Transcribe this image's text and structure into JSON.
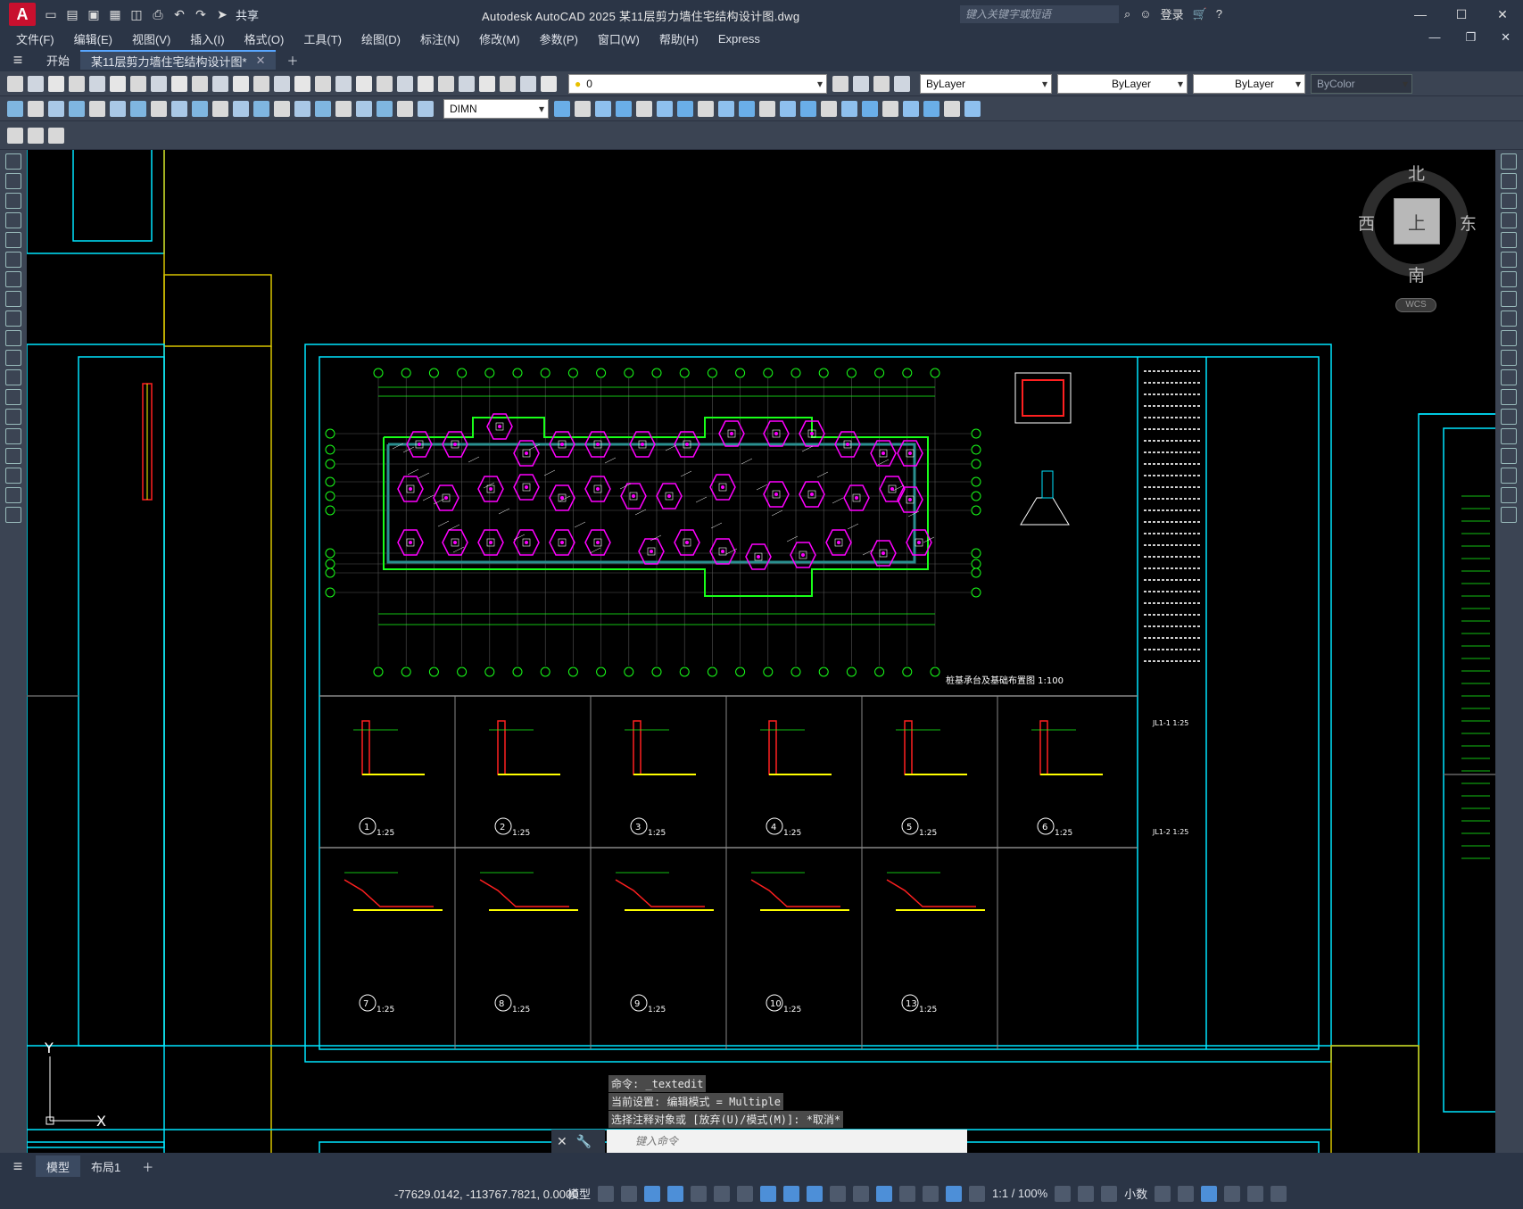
{
  "app": {
    "logo": "A",
    "title": "Autodesk AutoCAD 2025    某11层剪力墙住宅结构设计图.dwg",
    "share_label": "共享",
    "search_placeholder": "键入关键字或短语",
    "login_label": "登录"
  },
  "menu": [
    "文件(F)",
    "编辑(E)",
    "视图(V)",
    "插入(I)",
    "格式(O)",
    "工具(T)",
    "绘图(D)",
    "标注(N)",
    "修改(M)",
    "参数(P)",
    "窗口(W)",
    "帮助(H)",
    "Express"
  ],
  "tabs": [
    {
      "label": "开始"
    },
    {
      "label": "某11层剪力墙住宅结构设计图*"
    }
  ],
  "toolbar": {
    "layer_name": "0",
    "color": "ByLayer",
    "linetype": "ByLayer",
    "lineweight": "ByLayer",
    "plotstyle": "ByColor",
    "dimstyle": "DIMN"
  },
  "viewcube": {
    "north": "北",
    "south": "南",
    "east": "东",
    "west": "西",
    "face": "上",
    "wcs": "WCS"
  },
  "drawing": {
    "plan_title": "桩基承台及基础布置图 1:100",
    "details_row1": [
      "1",
      "2",
      "3",
      "4",
      "5",
      "6"
    ],
    "details_row2": [
      "7",
      "8",
      "9",
      "10",
      "13"
    ],
    "scale_label": "1:25",
    "side_detail_1": "JL1-1 1:25",
    "side_detail_2": "JL1-2 1:25",
    "ucs_y": "Y",
    "ucs_x": "X"
  },
  "command": {
    "history": [
      "命令: _textedit",
      "当前设置: 编辑模式 = Multiple",
      "选择注释对象或 [放弃(U)/模式(M)]: *取消*"
    ],
    "placeholder": "键入命令"
  },
  "layouts": [
    "模型",
    "布局1"
  ],
  "status": {
    "coords": "-77629.0142, -113767.7821, 0.0000",
    "model_label": "模型",
    "scale": "1:1 / 100%",
    "units": "小数"
  },
  "colors": {
    "cyan": "#00e5ff",
    "green": "#19ff19",
    "magenta": "#ff00ff",
    "yellow": "#ffff00",
    "red": "#ff2020",
    "white": "#ffffff"
  }
}
